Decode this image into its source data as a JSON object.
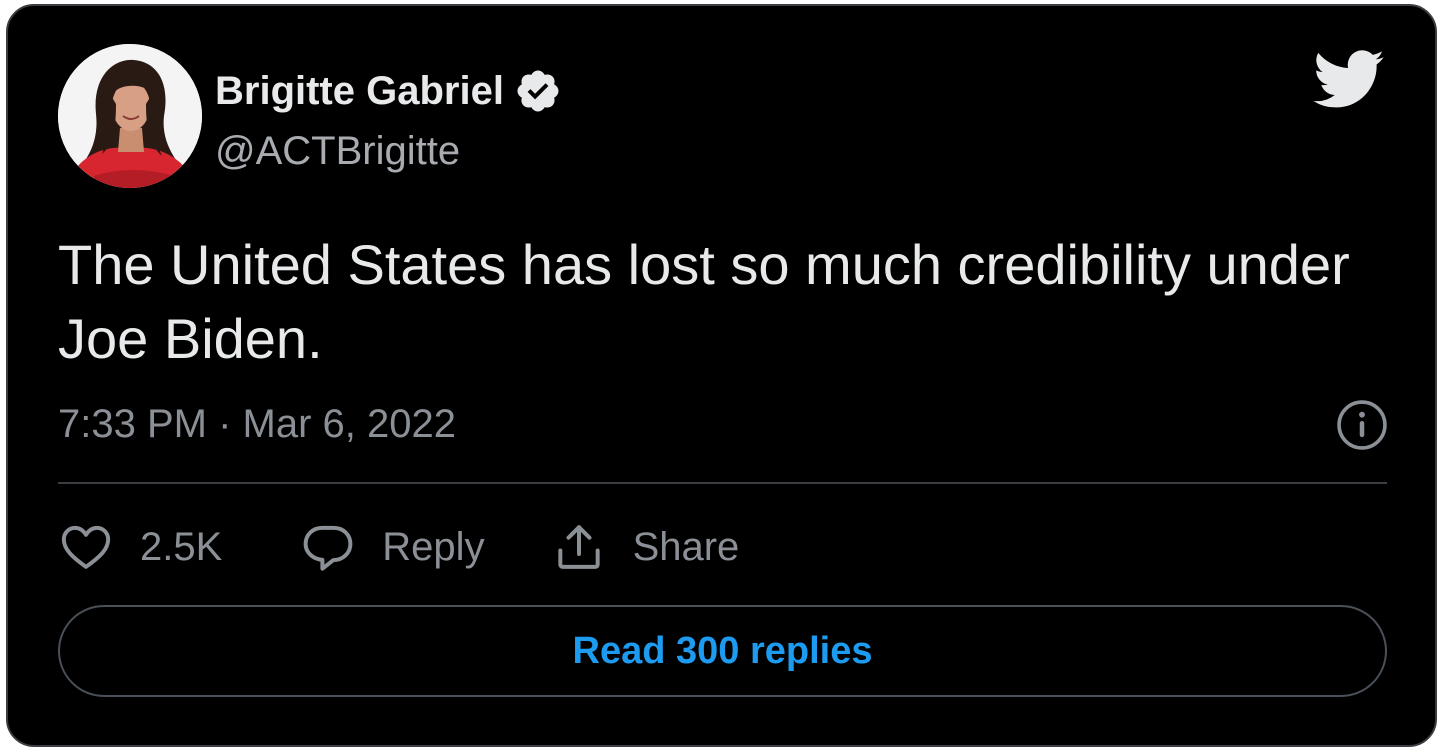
{
  "author": {
    "name": "Brigitte Gabriel",
    "handle": "@ACTBrigitte",
    "verified": true
  },
  "tweet": {
    "text": "The United States has lost so much credibility under Joe Biden.",
    "timestamp": "7:33 PM · Mar 6, 2022"
  },
  "actions": {
    "likes": "2.5K",
    "reply_label": "Reply",
    "share_label": "Share"
  },
  "read_replies_label": "Read 300 replies",
  "icons": {
    "brand": "twitter-bird-icon",
    "info": "info-icon",
    "like": "heart-icon",
    "reply": "speech-bubble-icon",
    "share": "share-upload-icon"
  },
  "colors": {
    "background": "#000000",
    "text": "#e7e9ea",
    "muted": "#8b9096",
    "accent": "#1d9bf0",
    "border": "#3a3d41"
  }
}
